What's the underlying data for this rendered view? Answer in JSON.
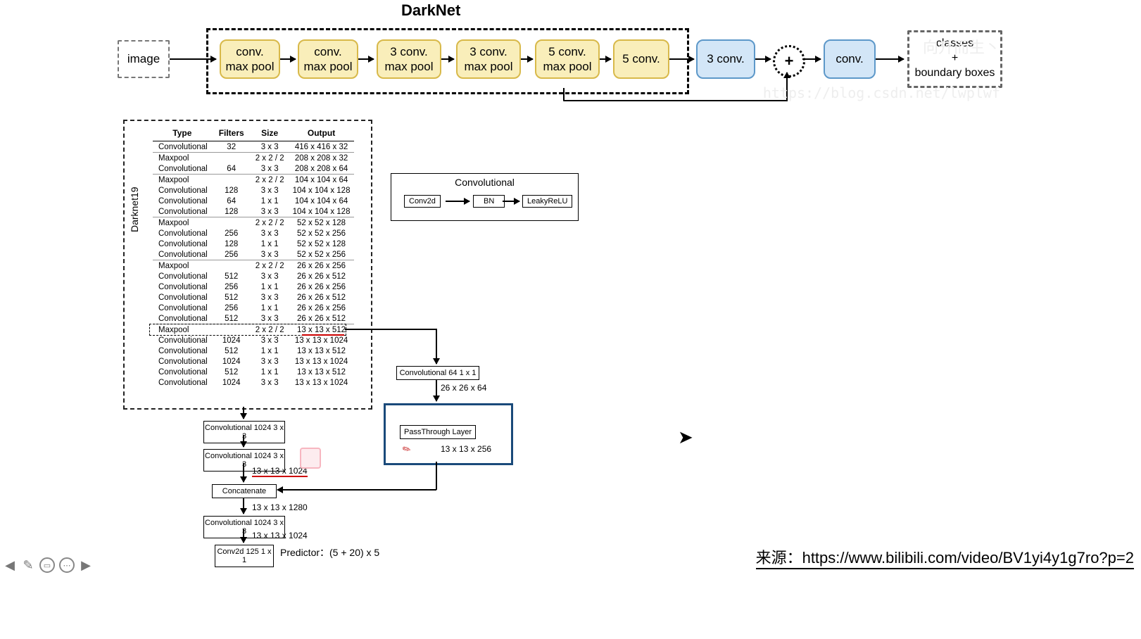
{
  "title": "DarkNet",
  "pipeline": {
    "image": "image",
    "y1": "conv.\nmax pool",
    "y2": "conv.\nmax pool",
    "y3": "3 conv.\nmax pool",
    "y4": "3 conv.\nmax pool",
    "y5": "5 conv.\nmax pool",
    "y6": "5 conv.",
    "b1": "3 conv.",
    "b2": "conv.",
    "plus": "+",
    "out_l1": "classes",
    "out_l2": "+",
    "out_l3": "boundary boxes"
  },
  "table": {
    "label": "Darknet19",
    "headers": [
      "Type",
      "Filters",
      "Size",
      "Output"
    ],
    "rows": [
      [
        "Convolutional",
        "32",
        "3 x 3",
        "416 x 416 x 32"
      ],
      [
        "Maxpool",
        "",
        "2 x 2 / 2",
        "208 x 208 x 32"
      ],
      [
        "Convolutional",
        "64",
        "3 x 3",
        "208 x 208 x 64"
      ],
      [
        "Maxpool",
        "",
        "2 x 2 / 2",
        "104 x 104 x 64"
      ],
      [
        "Convolutional",
        "128",
        "3 x 3",
        "104 x 104 x 128"
      ],
      [
        "Convolutional",
        "64",
        "1 x 1",
        "104 x 104 x 64"
      ],
      [
        "Convolutional",
        "128",
        "3 x 3",
        "104 x 104 x 128"
      ],
      [
        "Maxpool",
        "",
        "2 x 2 / 2",
        "52 x 52 x 128"
      ],
      [
        "Convolutional",
        "256",
        "3 x 3",
        "52 x 52 x 256"
      ],
      [
        "Convolutional",
        "128",
        "1 x 1",
        "52 x 52 x 128"
      ],
      [
        "Convolutional",
        "256",
        "3 x 3",
        "52 x 52 x 256"
      ],
      [
        "Maxpool",
        "",
        "2 x 2 / 2",
        "26 x 26 x 256"
      ],
      [
        "Convolutional",
        "512",
        "3 x 3",
        "26 x 26 x 512"
      ],
      [
        "Convolutional",
        "256",
        "1 x 1",
        "26 x 26 x 256"
      ],
      [
        "Convolutional",
        "512",
        "3 x 3",
        "26 x 26 x 512"
      ],
      [
        "Convolutional",
        "256",
        "1 x 1",
        "26 x 26 x 256"
      ],
      [
        "Convolutional",
        "512",
        "3 x 3",
        "26 x 26 x 512"
      ],
      [
        "Maxpool",
        "",
        "2 x 2 / 2",
        "13 x 13 x 512"
      ],
      [
        "Convolutional",
        "1024",
        "3 x 3",
        "13 x 13 x 1024"
      ],
      [
        "Convolutional",
        "512",
        "1 x 1",
        "13 x 13 x 512"
      ],
      [
        "Convolutional",
        "1024",
        "3 x 3",
        "13 x 13 x 1024"
      ],
      [
        "Convolutional",
        "512",
        "1 x 1",
        "13 x 13 x 512"
      ],
      [
        "Convolutional",
        "1024",
        "3 x 3",
        "13 x 13 x 1024"
      ]
    ]
  },
  "convblock": {
    "title": "Convolutional",
    "a": "Conv2d",
    "b": "BN",
    "c": "LeakyReLU"
  },
  "flow": {
    "c1": "Convolutional   1024  3 x 3",
    "c2": "Convolutional   1024  3 x 3",
    "t1": "13 x 13 x 1024",
    "cat": "Concatenate",
    "t2": "13 x 13 x 1280",
    "c3": "Convolutional   1024  3 x 3",
    "t3": "13 x 13 x 1024",
    "c4": "Conv2d   125  1 x 1",
    "pred": "Predictor：(5 + 20) x 5",
    "side": "Convolutional  64   1 x 1",
    "side_t": "26 x 26 x 64",
    "pt": "PassThrough Layer",
    "pt_t": "13 x 13 x 256"
  },
  "source": "来源：https://www.bilibili.com/video/BV1yi4y1g7ro?p=2",
  "wm1": "向升而生丶",
  "wm2": "https://blog.csdn.net/lwplwf"
}
